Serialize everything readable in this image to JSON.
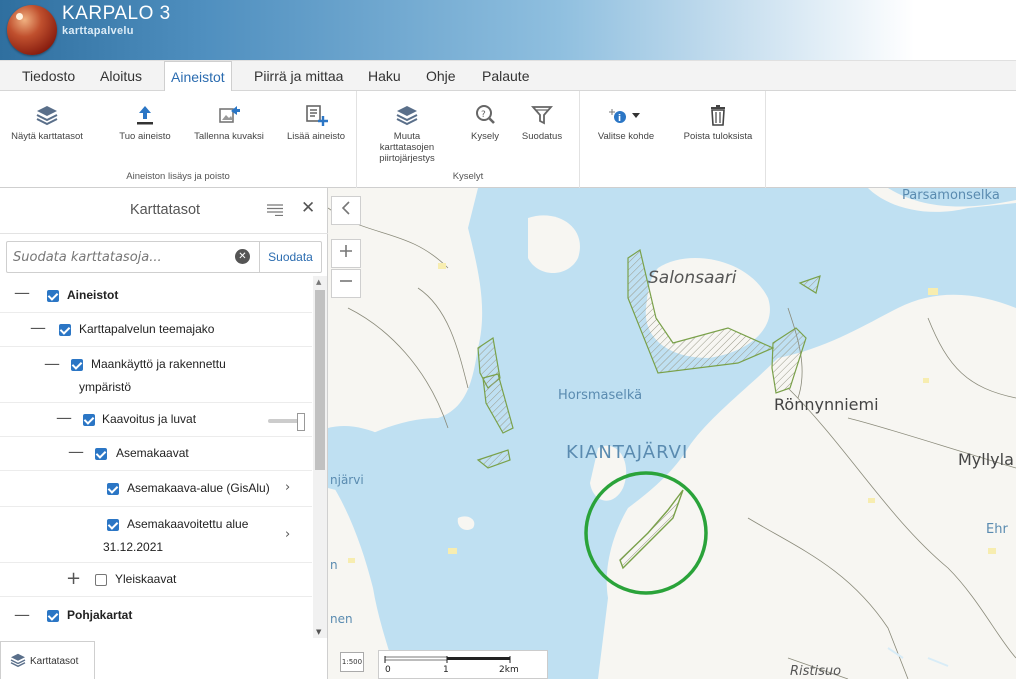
{
  "app": {
    "title": "KARPALO 3",
    "subtitle": "karttapalvelu"
  },
  "menu": [
    "Tiedosto",
    "Aloitus",
    "Aineistot",
    "Piirrä ja mittaa",
    "Haku",
    "Ohje",
    "Palaute"
  ],
  "menu_active": "Aineistot",
  "ribbon": {
    "group1": {
      "label": "Aineiston lisäys ja poisto",
      "buttons": [
        "Näytä karttatasot",
        "Tuo aineisto",
        "Tallenna kuvaksi",
        "Lisää aineisto"
      ]
    },
    "group2": {
      "label": "Kyselyt",
      "reorder_lines": [
        "Muuta",
        "karttatasojen",
        "piirtojärjestys"
      ],
      "buttons": [
        "Kysely",
        "Suodatus"
      ]
    },
    "group3": {
      "buttons": [
        "Valitse kohde",
        "Poista tuloksista"
      ]
    }
  },
  "panel": {
    "title": "Karttatasot",
    "filter_placeholder": "Suodata karttatasoja...",
    "filter_button": "Suodata",
    "tree": {
      "aineistot": "Aineistot",
      "teemajako": "Karttapalvelun teemajako",
      "maankaytto_line1": "Maankäyttö ja rakennettu",
      "maankaytto_line2": "ympäristö",
      "kaavoitus": "Kaavoitus ja luvat",
      "asemakaavat": "Asemakaavat",
      "asemakaava_alue": "Asemakaava-alue (GisAlu)",
      "asemakaavoitettu_line1": "Asemakaavoitettu alue",
      "asemakaavoitettu_line2": "31.12.2021",
      "yleiskaavat": "Yleiskaavat",
      "pohjakartat": "Pohjakartat"
    },
    "bottom_tab": "Karttatasot"
  },
  "map": {
    "labels": {
      "salonsaari": "Salonsaari",
      "horsmaselka": "Horsmaselkä",
      "ronnynniemi": "Rönnynniemi",
      "kiantajarvi": "KIANTAJÄRVI",
      "myllyla": "Myllyla",
      "parsamonselka": "Parsamonselka",
      "ehr": "Ehr",
      "ristisuo": "Ristisuo",
      "njarvi": "njärvi",
      "n": "n",
      "nen": "nen"
    },
    "scale": {
      "ticks": [
        "0",
        "1",
        "2km"
      ],
      "denominator": "1:500"
    },
    "colors": {
      "water": "#bfe0f2",
      "land": "#f7f6f2",
      "highlight_circle": "#2aa33a",
      "plan_area": "#7aa14a"
    }
  }
}
